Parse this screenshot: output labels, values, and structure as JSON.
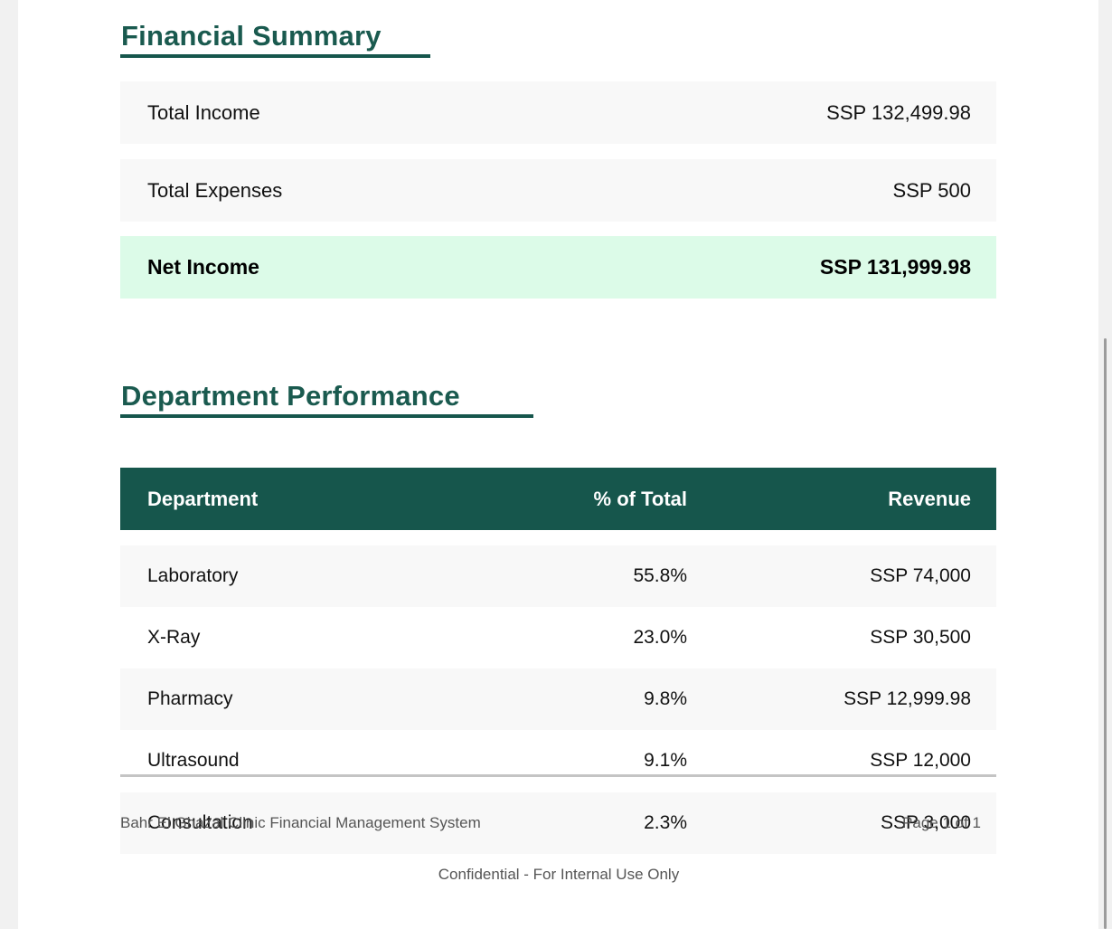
{
  "financial_summary": {
    "title": "Financial Summary",
    "rows": [
      {
        "label": "Total Income",
        "value": "SSP 132,499.98"
      },
      {
        "label": "Total Expenses",
        "value": "SSP 500"
      },
      {
        "label": "Net Income",
        "value": "SSP 131,999.98"
      }
    ]
  },
  "department_performance": {
    "title": "Department Performance",
    "headers": {
      "department": "Department",
      "percent": "% of Total",
      "revenue": "Revenue"
    },
    "rows": [
      {
        "department": "Laboratory",
        "percent": "55.8%",
        "revenue": "SSP 74,000"
      },
      {
        "department": "X-Ray",
        "percent": "23.0%",
        "revenue": "SSP 30,500"
      },
      {
        "department": "Pharmacy",
        "percent": "9.8%",
        "revenue": "SSP 12,999.98"
      },
      {
        "department": "Ultrasound",
        "percent": "9.1%",
        "revenue": "SSP 12,000"
      },
      {
        "department": "Consultation",
        "percent": "2.3%",
        "revenue": "SSP 3,000"
      }
    ]
  },
  "footer": {
    "system_name": "Bahr El Ghazal Clinic Financial Management System",
    "page": "Page 1 of 1",
    "confidential": "Confidential - For Internal Use Only"
  }
}
